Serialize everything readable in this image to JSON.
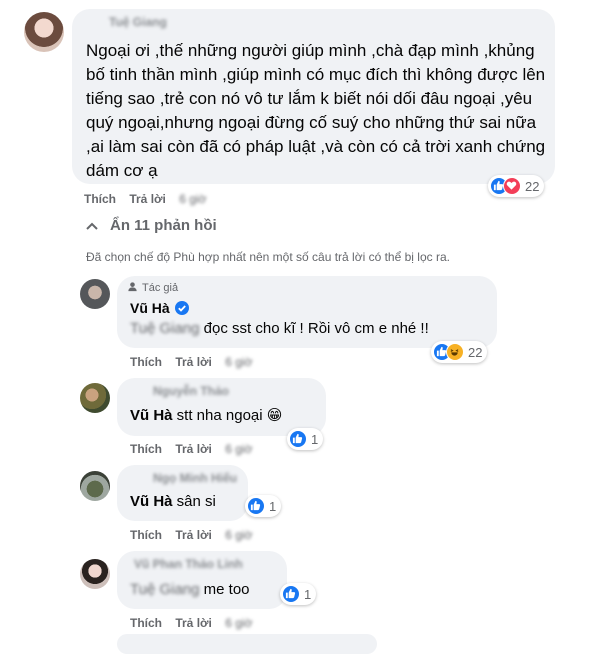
{
  "main_comment": {
    "author": "Tuệ Giang",
    "text": "Ngoại ơi ,thế những người giúp mình ,chà đạp mình ,khủng bố tinh thần mình ,giúp mình có mục đích thì không được lên tiếng sao ,trẻ con nó vô tư lắm k biết nói dối đâu ngoại ,yêu quý ngoại,nhưng ngoại đừng cố suý cho những thứ sai nữa ,ai làm sai còn đã có pháp luật ,và còn có cả trời xanh chứng dám cơ ạ",
    "actions": {
      "like": "Thích",
      "reply": "Trả lời",
      "time": "6 giờ"
    },
    "reactions": {
      "icons": [
        "like-icon",
        "love-icon"
      ],
      "count": "22"
    }
  },
  "replies_toggle": {
    "icon": "chevron-up-icon",
    "label": "Ẩn 11 phản hồi"
  },
  "filter_note": "Đã chọn chế độ Phù hợp nhất nên một số câu trả lời có thể bị lọc ra.",
  "replies": [
    {
      "badge": "Tác giả",
      "author": "Vũ Hà",
      "verified": true,
      "mention": "Tuệ Giang",
      "text": " đọc sst cho kĩ ! Rồi vô cm e nhé !!",
      "actions": {
        "like": "Thích",
        "reply": "Trả lời",
        "time": "6 giờ"
      },
      "reactions": {
        "icons": [
          "like-icon",
          "haha-icon"
        ],
        "count": "22"
      }
    },
    {
      "author": "Nguyễn Thảo",
      "mention": "Vũ Hà",
      "text": " stt nha ngoại 😁",
      "actions": {
        "like": "Thích",
        "reply": "Trả lời",
        "time": "6 giờ"
      },
      "reactions": {
        "icons": [
          "like-icon"
        ],
        "count": "1"
      }
    },
    {
      "author": "Ngọ Minh Hiếu",
      "mention": "Vũ Hà",
      "text": " sân si",
      "actions": {
        "like": "Thích",
        "reply": "Trả lời",
        "time": "6 giờ"
      },
      "reactions": {
        "icons": [
          "like-icon"
        ],
        "count": "1"
      }
    },
    {
      "author": "Vũ Phan Thảo Linh",
      "mention": "Tuệ Giang",
      "text": " me too",
      "actions": {
        "like": "Thích",
        "reply": "Trả lời",
        "time": "6 giờ"
      },
      "reactions": {
        "icons": [
          "like-icon"
        ],
        "count": "1"
      }
    }
  ],
  "colors": {
    "like": "#1877f2",
    "love": "#f33e58",
    "haha": "#f7b125",
    "verified": "#1877f2",
    "bubble": "#f0f2f5"
  }
}
